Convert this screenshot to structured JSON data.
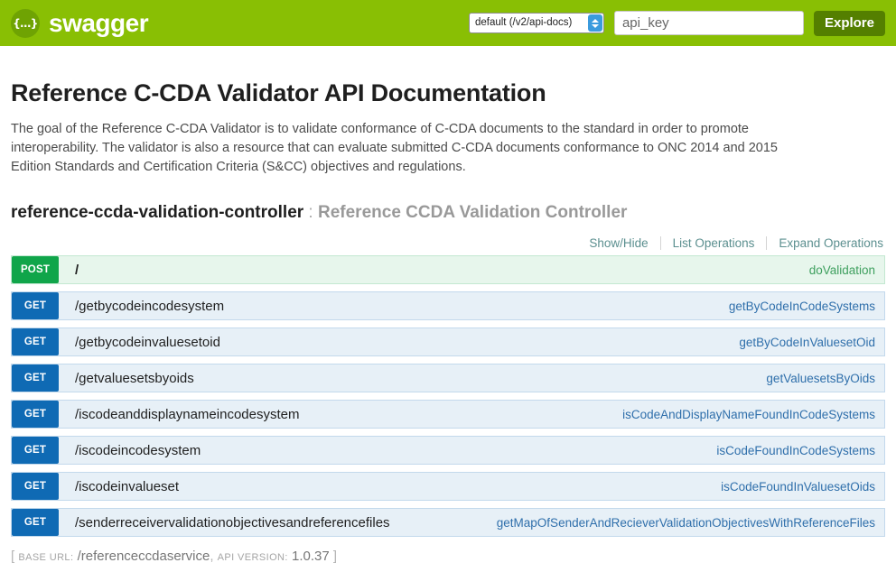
{
  "topbar": {
    "logo_glyph": "{…}",
    "brand": "swagger",
    "spec_select": {
      "selected": "default (/v2/api-docs)",
      "options": [
        "default (/v2/api-docs)"
      ]
    },
    "api_key": {
      "value": "",
      "placeholder": "api_key"
    },
    "explore_label": "Explore"
  },
  "main": {
    "title": "Reference C-CDA Validator API Documentation",
    "description": "The goal of the Reference C-CDA Validator is to validate conformance of C-CDA documents to the standard in order to promote interoperability. The validator is also a resource that can evaluate submitted C-CDA documents conformance to ONC 2014 and 2015 Edition Standards and Certification Criteria (S&CC) objectives and regulations.",
    "resource": {
      "name": "reference-ccda-validation-controller",
      "separator": " : ",
      "description": "Reference CCDA Validation Controller"
    },
    "options": {
      "show_hide": "Show/Hide",
      "list_operations": "List Operations",
      "expand_operations": "Expand Operations"
    },
    "operations": [
      {
        "method": "POST",
        "method_class": "post",
        "path": "/",
        "summary": "doValidation"
      },
      {
        "method": "GET",
        "method_class": "get",
        "path": "/getbycodeincodesystem",
        "summary": "getByCodeInCodeSystems"
      },
      {
        "method": "GET",
        "method_class": "get",
        "path": "/getbycodeinvaluesetoid",
        "summary": "getByCodeInValuesetOid"
      },
      {
        "method": "GET",
        "method_class": "get",
        "path": "/getvaluesetsbyoids",
        "summary": "getValuesetsByOids"
      },
      {
        "method": "GET",
        "method_class": "get",
        "path": "/iscodeanddisplaynameincodesystem",
        "summary": "isCodeAndDisplayNameFoundInCodeSystems"
      },
      {
        "method": "GET",
        "method_class": "get",
        "path": "/iscodeincodesystem",
        "summary": "isCodeFoundInCodeSystems"
      },
      {
        "method": "GET",
        "method_class": "get",
        "path": "/iscodeinvalueset",
        "summary": "isCodeFoundInValuesetOids"
      },
      {
        "method": "GET",
        "method_class": "get",
        "path": "/senderreceivervalidationobjectivesandreferencefiles",
        "summary": "getMapOfSenderAndRecieverValidationObjectivesWithReferenceFiles"
      }
    ]
  },
  "footer": {
    "open_bracket": "[",
    "base_url_label": "BASE URL:",
    "base_url_value": "/referenceccdaservice",
    "comma": ",",
    "api_version_label": "API VERSION:",
    "api_version_value": "1.0.37",
    "close_bracket": "]"
  },
  "colors": {
    "brand_green": "#89bf04",
    "explore_green": "#547f00",
    "get_blue": "#0f6ab4",
    "post_green": "#10a54a",
    "get_row_bg": "#e7f0f7",
    "post_row_bg": "#e7f6ec"
  }
}
